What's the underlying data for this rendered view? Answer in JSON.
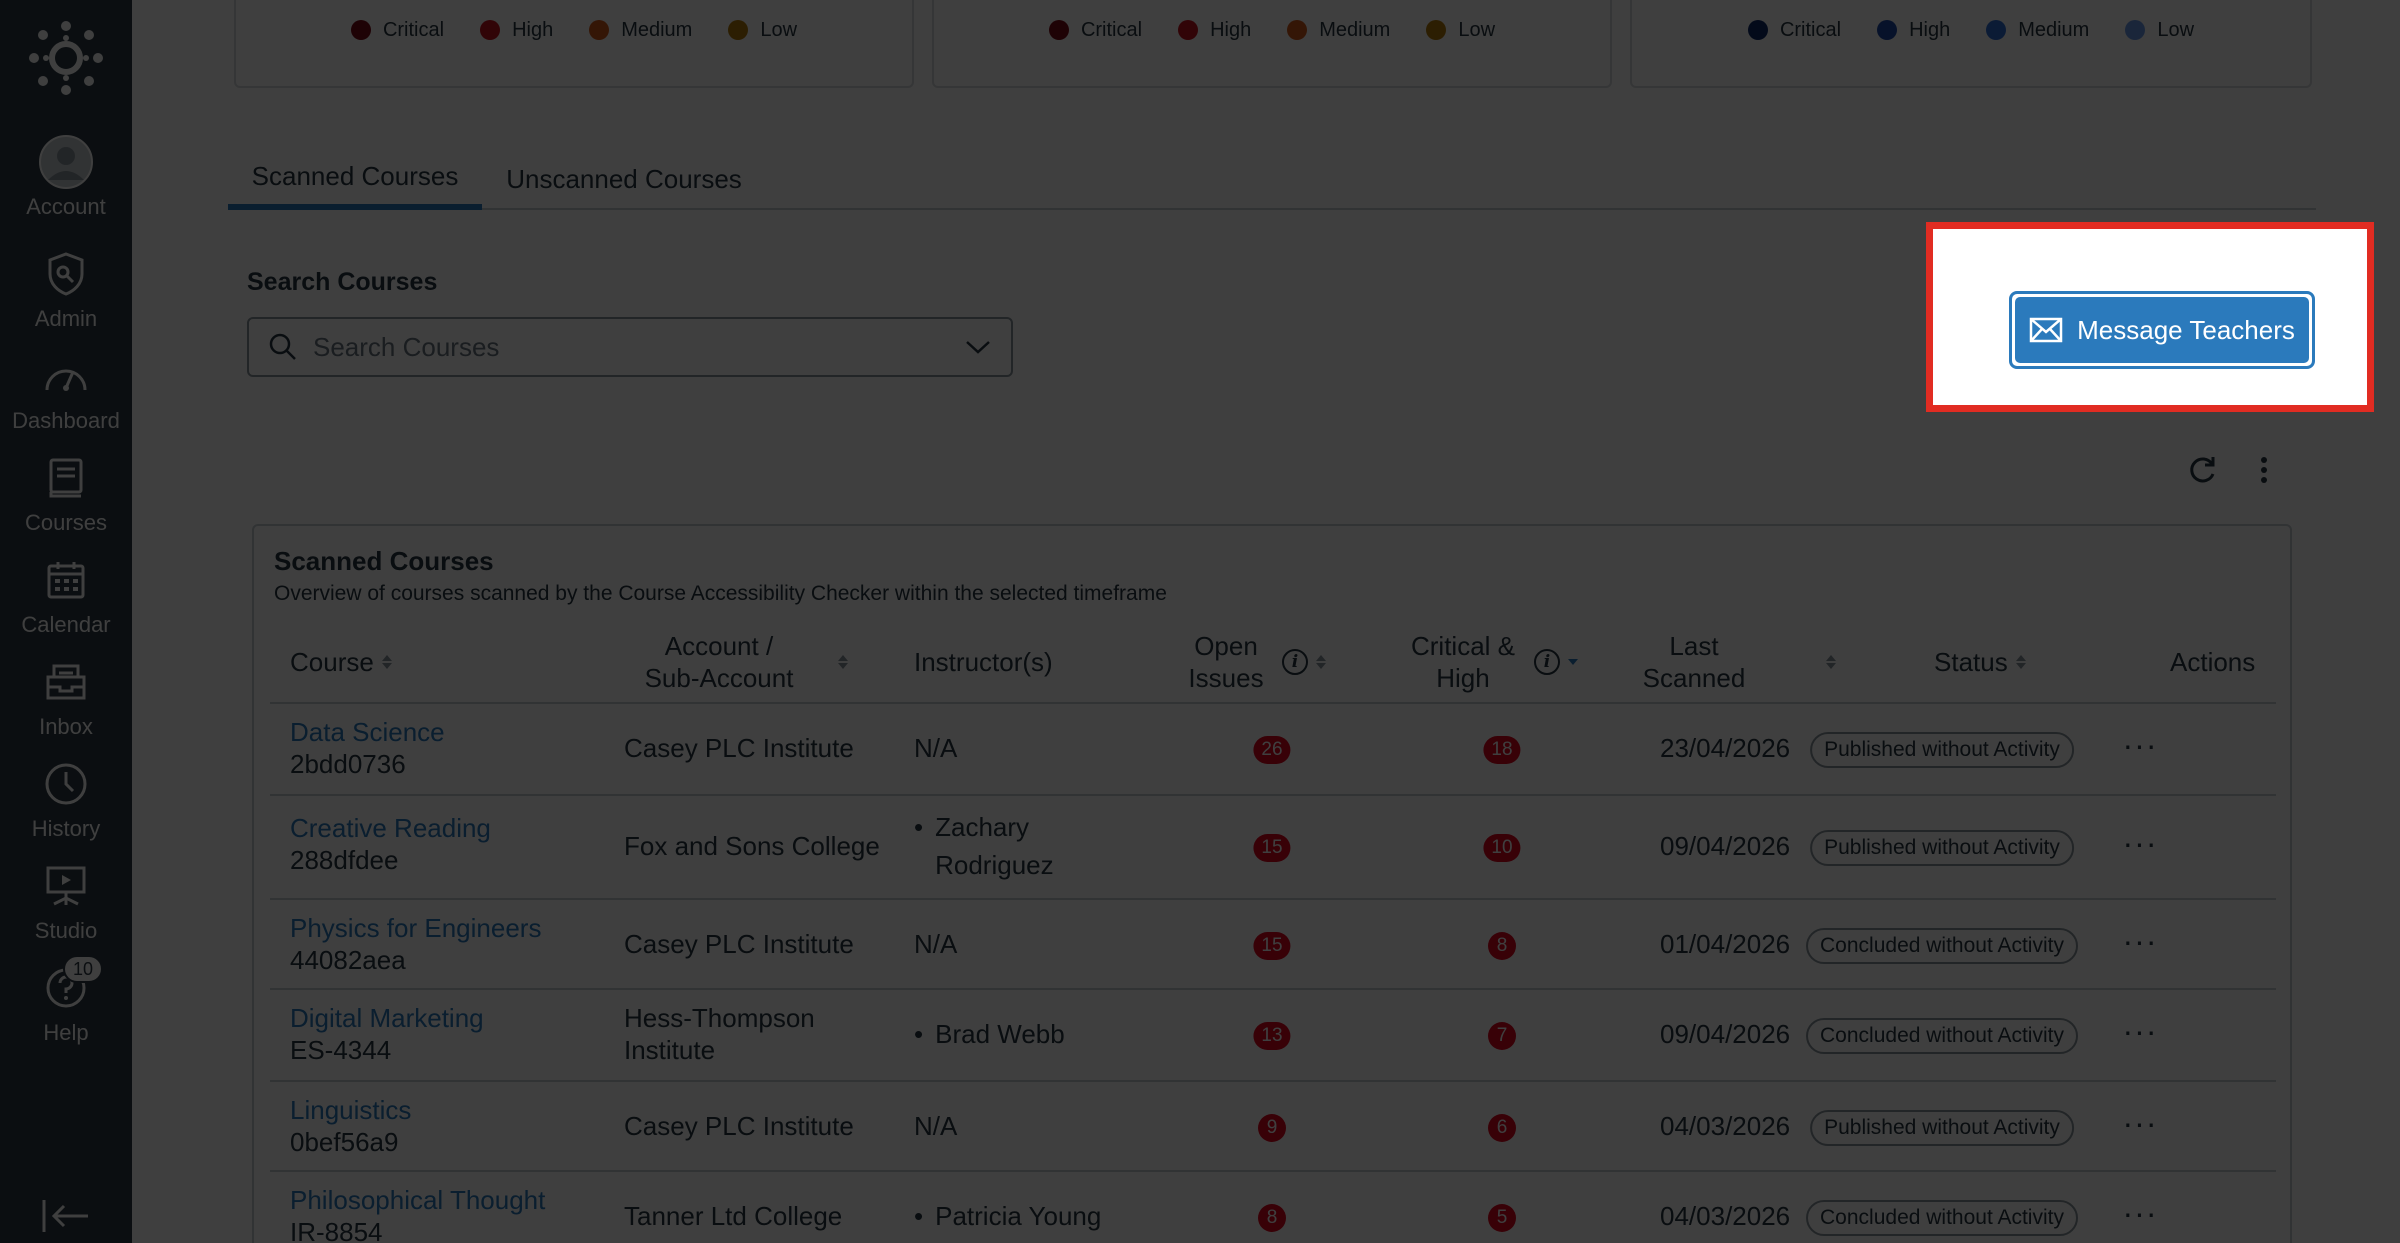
{
  "sidebar": {
    "items": [
      {
        "label": "Account",
        "icon": "account-icon"
      },
      {
        "label": "Admin",
        "icon": "admin-icon"
      },
      {
        "label": "Dashboard",
        "icon": "dashboard-icon"
      },
      {
        "label": "Courses",
        "icon": "courses-icon"
      },
      {
        "label": "Calendar",
        "icon": "calendar-icon"
      },
      {
        "label": "Inbox",
        "icon": "inbox-icon"
      },
      {
        "label": "History",
        "icon": "history-icon"
      },
      {
        "label": "Studio",
        "icon": "studio-icon"
      },
      {
        "label": "Help",
        "icon": "help-icon"
      }
    ],
    "help_badge": "10"
  },
  "legends": [
    {
      "items": [
        {
          "label": "Critical",
          "color": "#7a0a16"
        },
        {
          "label": "High",
          "color": "#c4111f"
        },
        {
          "label": "Medium",
          "color": "#d15a1a"
        },
        {
          "label": "Low",
          "color": "#b0790a"
        }
      ]
    },
    {
      "items": [
        {
          "label": "Critical",
          "color": "#7a0a16"
        },
        {
          "label": "High",
          "color": "#c4111f"
        },
        {
          "label": "Medium",
          "color": "#d15a1a"
        },
        {
          "label": "Low",
          "color": "#b0790a"
        }
      ]
    },
    {
      "items": [
        {
          "label": "Critical",
          "color": "#0e2a6b"
        },
        {
          "label": "High",
          "color": "#1d4aa8"
        },
        {
          "label": "Medium",
          "color": "#2e6fd6"
        },
        {
          "label": "Low",
          "color": "#6a9bea"
        }
      ]
    }
  ],
  "tabs": [
    {
      "label": "Scanned Courses",
      "active": true
    },
    {
      "label": "Unscanned Courses",
      "active": false
    }
  ],
  "search": {
    "label": "Search Courses",
    "placeholder": "Search Courses"
  },
  "message_button": {
    "label": "Message Teachers"
  },
  "table": {
    "title": "Scanned Courses",
    "subtitle": "Overview of courses scanned by the Course Accessibility Checker within the selected timeframe",
    "headers": {
      "course": "Course",
      "account": "Account / Sub-Account",
      "instructors": "Instructor(s)",
      "open_issues": "Open Issues",
      "critical_high": "Critical & High",
      "last_scanned": "Last Scanned",
      "status": "Status",
      "actions": "Actions"
    },
    "rows": [
      {
        "course": "Data Science",
        "code": "2bdd0736",
        "account": "Casey PLC Institute",
        "instructor": "N/A",
        "instructor_bullet": false,
        "open": "26",
        "critical": "18",
        "scanned": "23/04/2026",
        "status": "Published without Activity"
      },
      {
        "course": "Creative Reading",
        "code": "288dfdee",
        "account": "Fox and Sons College",
        "instructor": "Zachary Rodriguez",
        "instructor_bullet": true,
        "open": "15",
        "critical": "10",
        "scanned": "09/04/2026",
        "status": "Published without Activity"
      },
      {
        "course": "Physics for Engineers",
        "code": "44082aea",
        "account": "Casey PLC Institute",
        "instructor": "N/A",
        "instructor_bullet": false,
        "open": "15",
        "critical": "8",
        "scanned": "01/04/2026",
        "status": "Concluded without Activity"
      },
      {
        "course": "Digital Marketing",
        "code": "ES-4344",
        "account": "Hess-Thompson Institute",
        "instructor": "Brad Webb",
        "instructor_bullet": true,
        "open": "13",
        "critical": "7",
        "scanned": "09/04/2026",
        "status": "Concluded without Activity"
      },
      {
        "course": "Linguistics",
        "code": "0bef56a9",
        "account": "Casey PLC Institute",
        "instructor": "N/A",
        "instructor_bullet": false,
        "open": "9",
        "critical": "6",
        "scanned": "04/03/2026",
        "status": "Published without Activity"
      },
      {
        "course": "Philosophical Thought",
        "code": "IR-8854",
        "account": "Tanner Ltd College",
        "instructor": "Patricia Young",
        "instructor_bullet": true,
        "open": "8",
        "critical": "5",
        "scanned": "04/03/2026",
        "status": "Concluded without Activity"
      }
    ]
  },
  "colors": {
    "accent": "#2b7abc",
    "badge": "#e0061f",
    "highlight": "#e12c22",
    "sidebar": "#2d3b45"
  }
}
